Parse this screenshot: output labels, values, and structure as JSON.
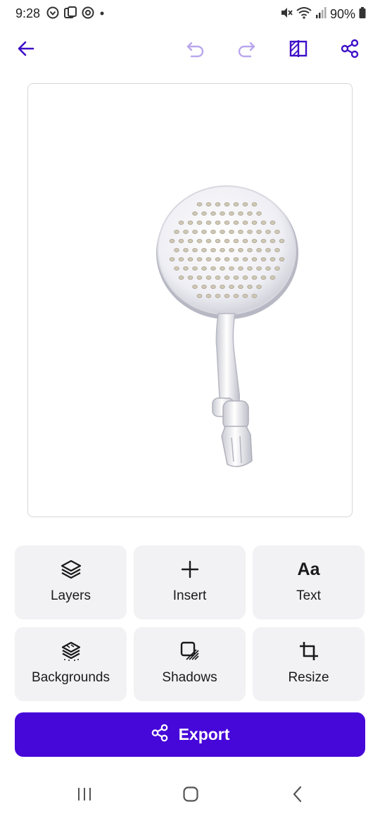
{
  "status_bar": {
    "time": "9:28",
    "battery": "90%",
    "left_icons": [
      "app-notification-icon",
      "cards-icon",
      "sync-icon",
      "dot-icon"
    ],
    "right_icons": [
      "mute-icon",
      "wifi-icon",
      "signal-icon",
      "battery-icon"
    ]
  },
  "toolbar": {
    "back_icon": "arrow-left-icon",
    "undo_icon": "undo-icon",
    "redo_icon": "redo-icon",
    "compare_icon": "compare-icon",
    "share_icon": "share-icon"
  },
  "canvas": {
    "subject": "shower-head-image"
  },
  "tools": [
    {
      "label": "Layers",
      "icon": "layers-icon"
    },
    {
      "label": "Insert",
      "icon": "plus-icon"
    },
    {
      "label": "Text",
      "icon": "text-icon",
      "glyph": "Aa"
    },
    {
      "label": "Backgrounds",
      "icon": "backgrounds-icon"
    },
    {
      "label": "Shadows",
      "icon": "shadows-icon"
    },
    {
      "label": "Resize",
      "icon": "crop-icon"
    }
  ],
  "export": {
    "label": "Export",
    "icon": "share-icon"
  },
  "nav": {
    "recents_icon": "recents-icon",
    "home_icon": "home-icon",
    "back_icon": "back-chevron-icon"
  },
  "colors": {
    "accent": "#4607d9",
    "icon_active": "#3d0fc7",
    "icon_disabled": "#b9a6ee",
    "tile_bg": "#f2f2f4"
  }
}
